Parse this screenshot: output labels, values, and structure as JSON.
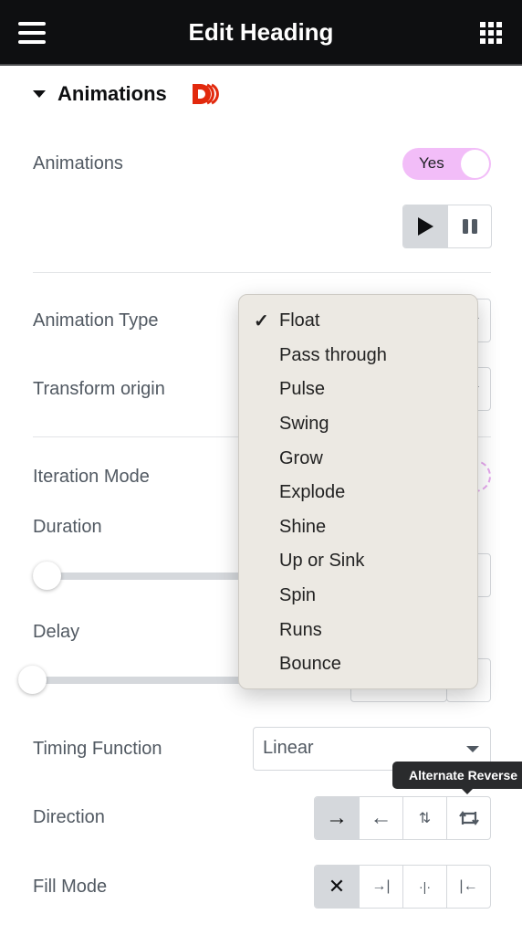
{
  "header": {
    "title": "Edit Heading",
    "menu_icon": "hamburger-icon",
    "apps_icon": "grid-icon"
  },
  "section": {
    "title": "Animations",
    "collapse_icon": "caret-down-icon",
    "badge_icon": "d-logo-icon",
    "badge_color": "#e2290d"
  },
  "fields": {
    "animations": {
      "label": "Animations",
      "toggle_label": "Yes",
      "toggle_on": true,
      "toggle_color": "#f2bdf8"
    },
    "playback": {
      "buttons": [
        {
          "icon": "play-icon",
          "glyph": "▶",
          "active": true
        },
        {
          "icon": "pause-icon",
          "glyph": "❚❚",
          "active": false
        }
      ]
    },
    "animation_type": {
      "label": "Animation Type",
      "selected": "Float"
    },
    "transform_origin": {
      "label": "Transform origin"
    },
    "iteration_mode": {
      "label": "Iteration Mode"
    },
    "duration": {
      "label": "Duration",
      "value_fraction": 0.0
    },
    "delay": {
      "label": "Delay",
      "value_fraction": 0.0
    },
    "timing_function": {
      "label": "Timing Function",
      "value": "Linear"
    },
    "direction": {
      "label": "Direction",
      "buttons": [
        {
          "icon": "arrow-right-icon",
          "glyph": "→",
          "active": true
        },
        {
          "icon": "arrow-left-icon",
          "glyph": "←",
          "active": false
        },
        {
          "icon": "alternate-icon",
          "glyph": "⇅",
          "active": false
        },
        {
          "icon": "alternate-reverse-icon",
          "glyph": "⮂",
          "active": false
        }
      ],
      "tooltip": "Alternate Reverse"
    },
    "fill_mode": {
      "label": "Fill Mode",
      "buttons": [
        {
          "icon": "none-x-icon",
          "glyph": "✕",
          "active": true
        },
        {
          "icon": "forwards-icon",
          "glyph": "→|",
          "active": false
        },
        {
          "icon": "both-icon",
          "glyph": "·|·",
          "active": false
        },
        {
          "icon": "backwards-icon",
          "glyph": "|←",
          "active": false
        }
      ]
    }
  },
  "dropdown": {
    "checkmark": "✓",
    "options": [
      "Float",
      "Pass through",
      "Pulse",
      "Swing",
      "Grow",
      "Explode",
      "Shine",
      "Up or Sink",
      "Spin",
      "Runs",
      "Bounce"
    ],
    "selected_index": 0
  }
}
